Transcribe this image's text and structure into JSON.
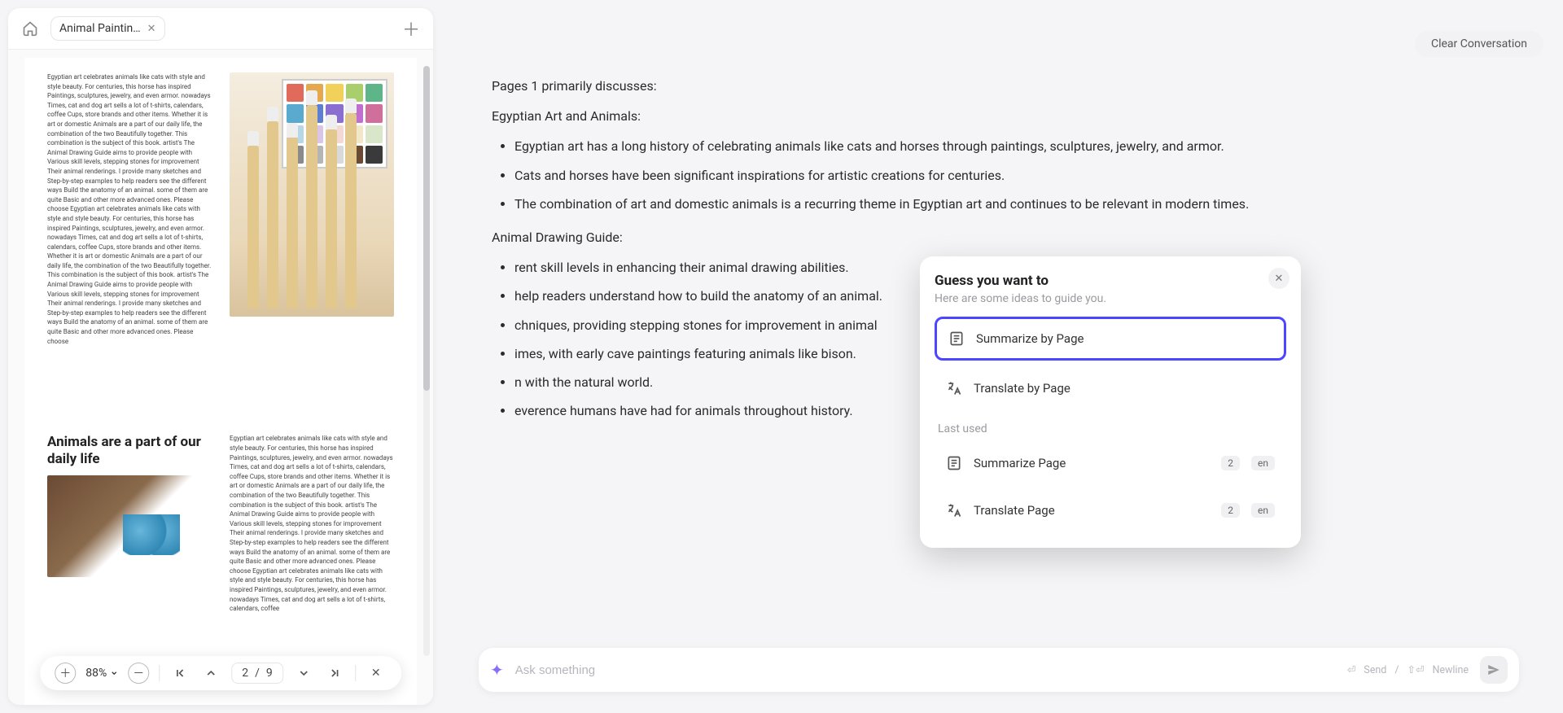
{
  "tab": {
    "title": "Animal Paintin…"
  },
  "toolbar": {
    "zoom_label": "88%",
    "page_current": "2",
    "page_sep": "/",
    "page_total": "9"
  },
  "doc": {
    "heading": "Animals are a part of our daily life",
    "para_a": "Egyptian art celebrates animals like cats with style and style beauty. For centuries, this horse has inspired Paintings, sculptures, jewelry, and even armor. nowadays Times, cat and dog art sells a lot of t-shirts, calendars, coffee Cups, store brands and other items. Whether it is art or domestic Animals are a part of our daily life, the combination of the two Beautifully together. This combination is the subject of this book. artist's The Animal Drawing Guide aims to provide people with Various skill levels, stepping stones for improvement Their animal renderings. I provide many sketches and Step-by-step examples to help readers see the different ways Build the anatomy of an animal. some of them are quite Basic and other more advanced ones. Please choose Egyptian art celebrates animals like cats with style and style beauty. For centuries, this horse has inspired Paintings, sculptures, jewelry, and even armor. nowadays Times, cat and dog art sells a lot of t-shirts, calendars, coffee Cups, store brands and other items. Whether it is art or domestic Animals are a part of our daily life, the combination of the two Beautifully together. This combination is the subject of this book. artist's The Animal Drawing Guide aims to provide people with Various skill levels, stepping stones for improvement Their animal renderings. I provide many sketches and Step-by-step examples to help readers see the different ways Build the anatomy of an animal. some of them are quite Basic and other more advanced ones. Please choose",
    "para_d": "Egyptian art celebrates animals like cats with style and style beauty. For centuries, this horse has inspired Paintings, sculptures, jewelry, and even armor. nowadays Times, cat and dog art sells a lot of t-shirts, calendars, coffee Cups, store brands and other items. Whether it is art or domestic Animals are a part of our daily life, the combination of the two Beautifully together. This combination is the subject of this book. artist's The Animal Drawing Guide aims to provide people with Various skill levels, stepping stones for improvement Their animal renderings. I provide many sketches and Step-by-step examples to help readers see the different ways Build the anatomy of an animal. some of them are quite Basic and other more advanced ones. Please choose Egyptian art celebrates animals like cats with style and style beauty. For centuries, this horse has inspired Paintings, sculptures, jewelry, and even armor. nowadays Times, cat and dog art sells a lot of t-shirts, calendars, coffee"
  },
  "chat": {
    "clear_label": "Clear Conversation",
    "line0": "Pages 1 primarily discusses:",
    "sec1": "Egyptian Art and Animals:",
    "b1": "Egyptian art has a long history of celebrating animals like cats and horses through paintings, sculptures, jewelry, and armor.",
    "b2": "Cats and horses have been significant inspirations for artistic creations for centuries.",
    "b3": "The combination of art and domestic animals is a recurring theme in Egyptian art and continues to be relevant in modern times.",
    "sec2": "Animal Drawing Guide:",
    "b4_tail": "rent skill levels in enhancing their animal drawing abilities.",
    "b5_tail": "help readers understand how to build the anatomy of an animal.",
    "b6_tail": "chniques, providing stepping stones for improvement in animal",
    "b7_tail": "imes, with early cave paintings featuring animals like bison.",
    "b8_tail": "n with the natural world.",
    "b9_tail": "everence humans have had for animals throughout history."
  },
  "popover": {
    "title": "Guess you want to",
    "subtitle": "Here are some ideas to guide you.",
    "item1": "Summarize by Page",
    "item2": "Translate by Page",
    "last_used": "Last used",
    "recent1": {
      "label": "Summarize Page",
      "badge_num": "2",
      "badge_lang": "en"
    },
    "recent2": {
      "label": "Translate Page",
      "badge_num": "2",
      "badge_lang": "en"
    }
  },
  "input": {
    "placeholder": "Ask something",
    "hint_send": "Send",
    "hint_sep": "/",
    "hint_newline": "Newline"
  }
}
